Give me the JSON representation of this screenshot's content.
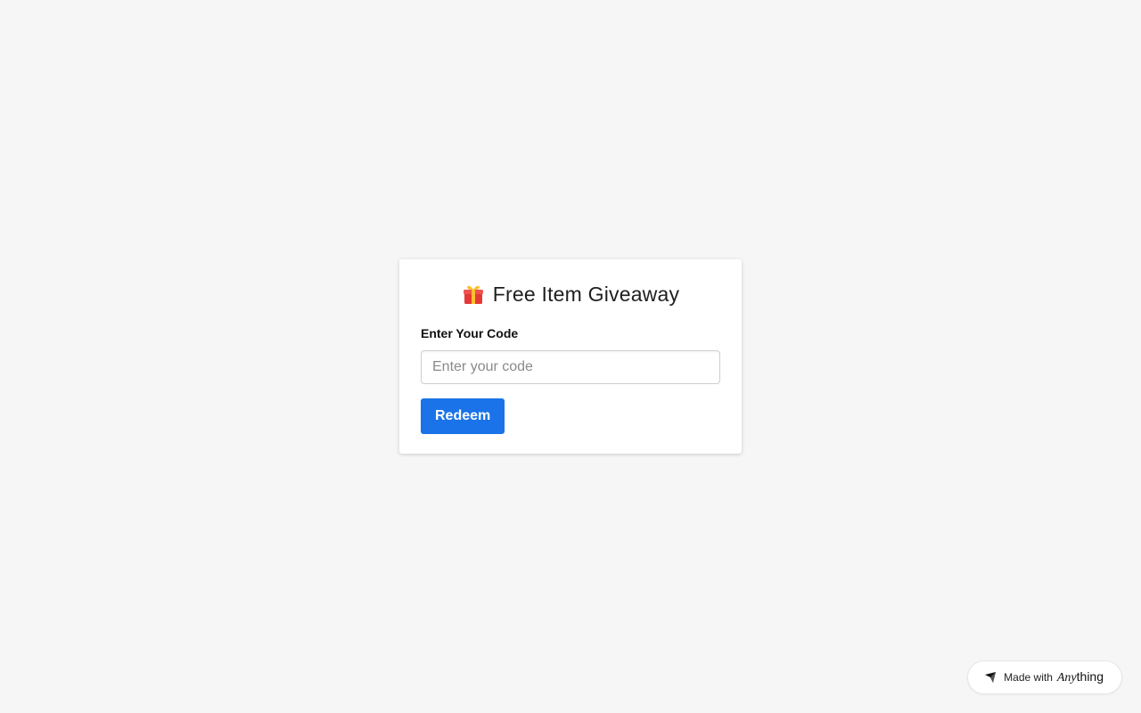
{
  "page": {
    "background": "#f6f6f6"
  },
  "card": {
    "title_icon": "gift-icon",
    "title": "Free Item Giveaway",
    "label": "Enter Your Code",
    "input": {
      "value": "",
      "placeholder": "Enter your code"
    },
    "button_label": "Redeem",
    "accent": "#1a73e8"
  },
  "badge": {
    "icon": "anything-logo-icon",
    "prefix": "Made with",
    "brand_part1": "Any",
    "brand_part2": "thing"
  }
}
